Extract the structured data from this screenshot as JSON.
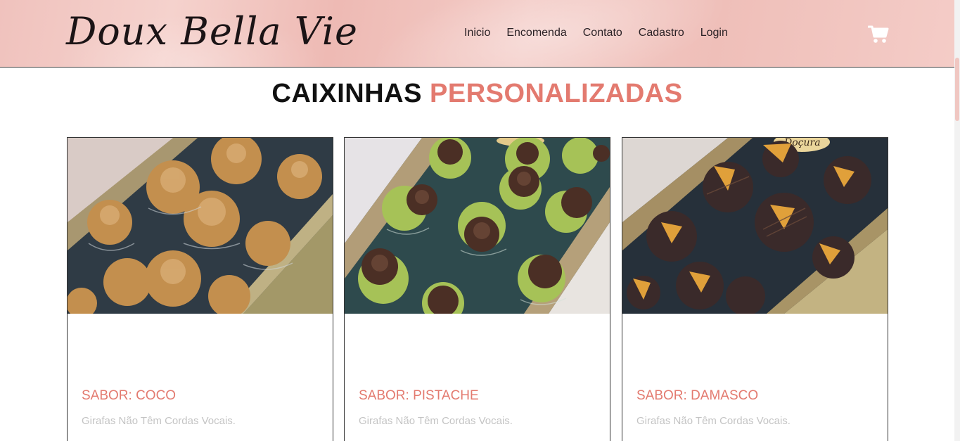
{
  "header": {
    "logo_text": "Doux Bella Vie",
    "nav": [
      "Inicio",
      "Encomenda",
      "Contato",
      "Cadastro",
      "Login"
    ],
    "cart_icon": "shopping-cart-icon"
  },
  "section": {
    "title_part1": "CAIXINHAS",
    "title_part2": "PERSONALIZADAS"
  },
  "products": [
    {
      "flavor": "SABOR: COCO",
      "description": "Girafas Não Têm Cordas Vocais.",
      "image": "coconut-truffles-box"
    },
    {
      "flavor": "SABOR: PISTACHE",
      "description": "Girafas Não Têm Cordas Vocais.",
      "image": "pistachio-truffles-box"
    },
    {
      "flavor": "SABOR: DAMASCO",
      "description": "Girafas Não Têm Cordas Vocais.",
      "image": "apricot-truffles-box"
    }
  ],
  "colors": {
    "header_pink": "#f0c2bd",
    "accent_salmon": "#e37a6f",
    "muted_text": "#c4c4c4"
  }
}
